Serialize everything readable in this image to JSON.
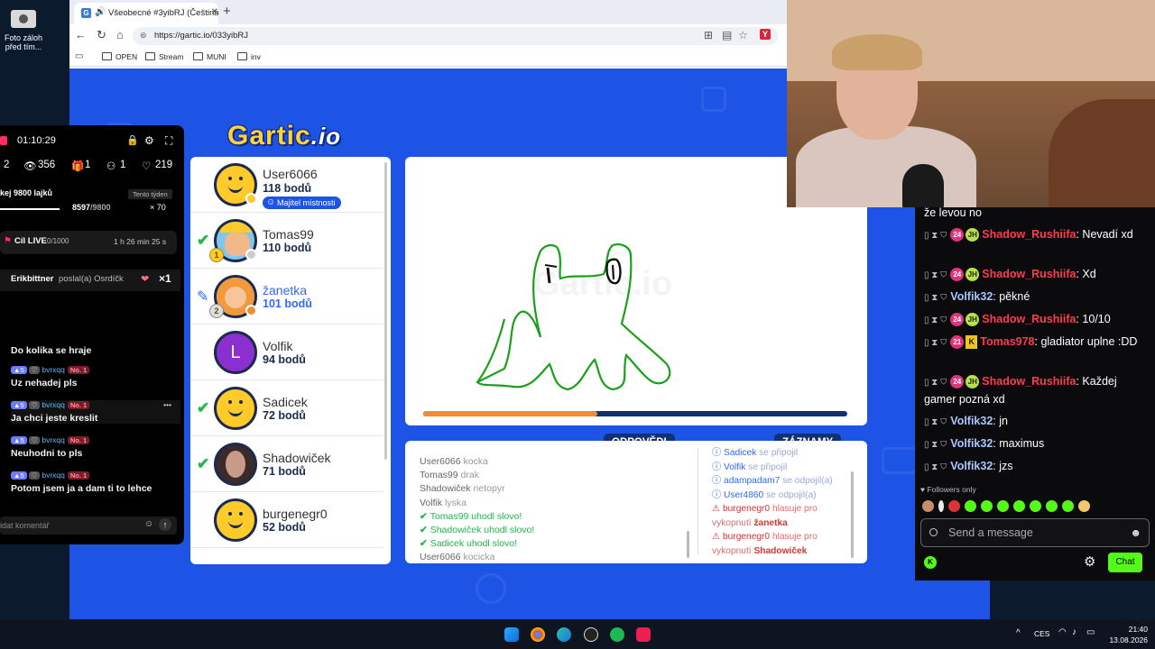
{
  "desktop": {
    "icon_label_1": "Foto záloh",
    "icon_label_2": "před tím..."
  },
  "browser": {
    "tab_title": "Všeobecné #3yibRJ (Čeština)",
    "url": "https://gartic.io/033yibRJ",
    "bookmarks": [
      "OPEN",
      "Stream",
      "MUNI",
      "inv"
    ]
  },
  "game": {
    "logo_main": "Gartic",
    "logo_suffix": ".io",
    "players": [
      {
        "name": "User6066",
        "points": "118 bodů",
        "owner_badge": "Majitel místnosti"
      },
      {
        "name": "Tomas99",
        "points": "110 bodů"
      },
      {
        "name": "žanetka",
        "points": "101 bodů"
      },
      {
        "name": "Volfik",
        "points": "94 bodů",
        "initial": "L"
      },
      {
        "name": "Sadicek",
        "points": "72 bodů"
      },
      {
        "name": "Shadowiček",
        "points": "71 bodů"
      },
      {
        "name": "burgenegr0",
        "points": "52 bodů"
      }
    ],
    "trophy_ranks": [
      "1",
      "2"
    ],
    "canvas_watermark": "Gartic.io",
    "timer_progress": 0.41,
    "answers_tab": "ODPOVĚDI",
    "records_tab": "ZÁZNAMY",
    "answers": [
      {
        "user": "User6066",
        "word": "kocka"
      },
      {
        "user": "Tomas99",
        "word": "drak"
      },
      {
        "user": "Shadowiček",
        "word": "netopyr"
      },
      {
        "user": "Volfik",
        "word": "lyska"
      }
    ],
    "guessed": [
      {
        "user": "Tomas99",
        "text": "uhodl slovo!"
      },
      {
        "user": "Shadowiček",
        "text": "uhodl slovo!"
      },
      {
        "user": "Sadicek",
        "text": "uhodl slovo!"
      }
    ],
    "answer_last": {
      "user": "User6066",
      "word": "kocicka"
    },
    "records": [
      {
        "user": "Sadicek",
        "text": "se připojil"
      },
      {
        "user": "Volfik",
        "text": "se připojil"
      },
      {
        "user": "adampadam7",
        "text": "se odpojil(a)"
      },
      {
        "user": "User4860",
        "text": "se odpojil(a)"
      }
    ],
    "warnings": [
      {
        "user": "burgenegr0",
        "text": "hlasuje pro vykopnutí",
        "target": "žanetka"
      },
      {
        "user": "burgenegr0",
        "text": "hlasuje pro vykopnutí",
        "target": "Shadowiček"
      }
    ]
  },
  "tiktok": {
    "timer": "01:10:29",
    "stat_a": "2",
    "viewers": "356",
    "gifts": "1",
    "joins": "1",
    "likes": "219",
    "likes_goal_label": "kej 9800 lajků",
    "likes_period": "Tento týden",
    "likes_count": "8597",
    "likes_total": "/9800",
    "likes_mult": "× 70",
    "live_goal_label": "Cíl LIVE",
    "live_goal_value": "0/1000",
    "live_goal_time": "1 h 26 min 25 s",
    "gift_user": "Erikbittner",
    "gift_text": "poslal(a) Osrdíčk",
    "gift_mult": "×1",
    "first_comment": "Do kolika se hraje",
    "comments": [
      {
        "level": "5",
        "nick": "bvrxqq",
        "rank": "No. 1",
        "text": "Uz nehadej pls"
      },
      {
        "level": "5",
        "nick": "bvrxqq",
        "rank": "No. 1",
        "text": "Ja chci jeste kreslit"
      },
      {
        "level": "5",
        "nick": "bvrxqq",
        "rank": "No. 1",
        "text": "Neuhodni to pls"
      },
      {
        "level": "5",
        "nick": "bvrxqq",
        "rank": "No. 1",
        "text": "Potom jsem ja a dam ti to lehce"
      }
    ],
    "input_placeholder": "idat komentář"
  },
  "chat": {
    "first_line": "že levou no",
    "messages": [
      {
        "badge": "24",
        "badge2": "JH",
        "user": "Shadow_Rushiifa",
        "style": "red",
        "text": "Nevadí xd"
      },
      {
        "badge": "24",
        "badge2": "JH",
        "user": "Shadow_Rushiifa",
        "style": "red",
        "text": "Xd"
      },
      {
        "user": "Volfik32",
        "style": "blue",
        "text": "pěkné"
      },
      {
        "badge": "24",
        "badge2": "JH",
        "user": "Shadow_Rushiifa",
        "style": "red",
        "text": "10/10"
      },
      {
        "badge": "21",
        "badge2": "K",
        "user": "Tomas978",
        "style": "red",
        "text": "gladiator uplne :DD"
      },
      {
        "badge": "24",
        "badge2": "JH",
        "user": "Shadow_Rushiifa",
        "style": "red",
        "text": "Každej gamer pozná xd"
      },
      {
        "user": "Volfik32",
        "style": "blue",
        "text": "jn"
      },
      {
        "user": "Volfik32",
        "style": "blue",
        "text": "maximus"
      },
      {
        "user": "Volfik32",
        "style": "blue",
        "text": "jzs"
      }
    ],
    "followers_only": "Followers only",
    "input_placeholder": "Send a message",
    "send_label": "Chat"
  },
  "taskbar": {
    "lang": "CES",
    "time": "21:40",
    "date": "13.08.2026"
  }
}
